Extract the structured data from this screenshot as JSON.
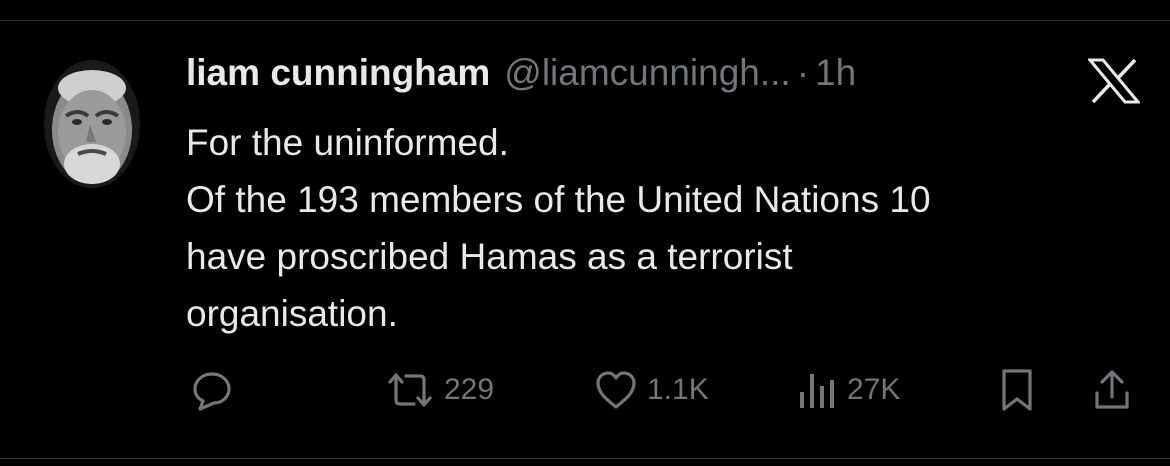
{
  "tweet": {
    "author_name": "liam cunningham",
    "handle": "@liamcunningh...",
    "separator": "·",
    "time": "1h",
    "lines": [
      "For the uninformed.",
      "Of the 193 members of the United Nations 10",
      "have proscribed Hamas as a terrorist",
      "organisation."
    ]
  },
  "actions": {
    "retweets": "229",
    "likes": "1.1K",
    "views": "27K"
  },
  "icons": {
    "platform": "x-logo-icon",
    "reply": "reply-icon",
    "retweet": "retweet-icon",
    "like": "heart-icon",
    "views": "views-icon",
    "bookmark": "bookmark-icon",
    "share": "share-icon"
  },
  "colors": {
    "background": "#000000",
    "primary_text": "#e7e9ea",
    "secondary_text": "#71767b",
    "divider": "#2f3336"
  }
}
